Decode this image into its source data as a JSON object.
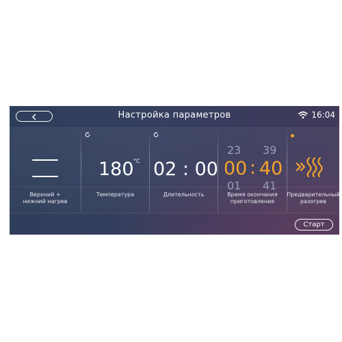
{
  "header": {
    "title": "Настройка параметров",
    "time": "16:04"
  },
  "modes": [
    {
      "label": "Верхний +\nнижний нагрев"
    },
    {
      "label": "Температура",
      "value": "180",
      "unit": "°C"
    },
    {
      "label": "Длительность",
      "value": "02 : 00"
    },
    {
      "label": "Время окончания приготовления",
      "hours_prev": "23",
      "hours": "00",
      "hours_next": "01",
      "separator": ":",
      "minutes_prev": "39",
      "minutes": "40",
      "minutes_next": "41"
    },
    {
      "label": "Предварительный разогрев",
      "enabled": true
    }
  ],
  "footer": {
    "start_label": "Старт"
  },
  "colors": {
    "accent": "#f3a42c",
    "text": "#ffffff"
  }
}
